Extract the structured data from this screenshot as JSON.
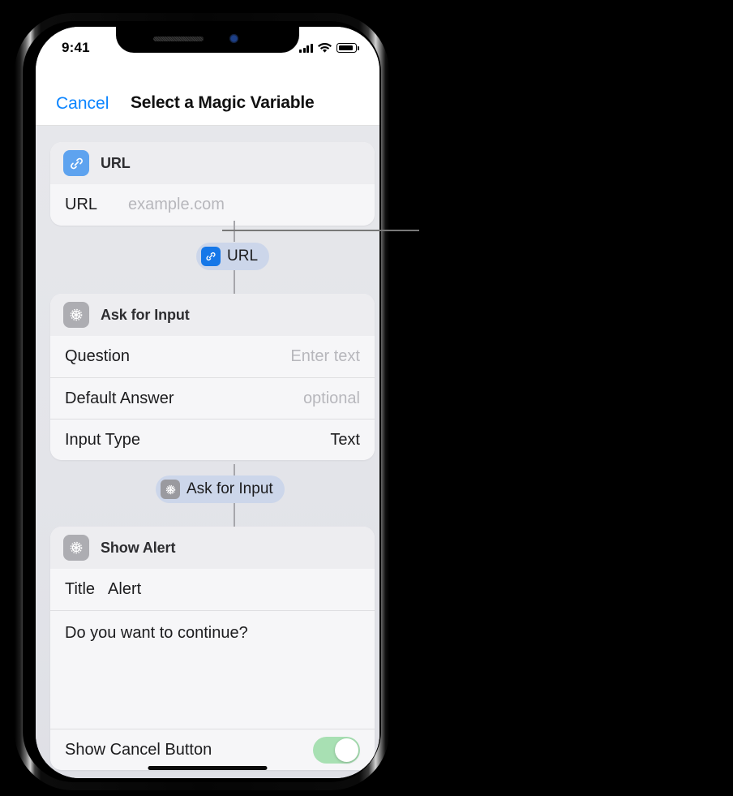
{
  "device": {
    "status_bar": {
      "time": "9:41",
      "cellular_icon": "signal-bars-icon",
      "wifi_icon": "wifi-icon",
      "battery_icon": "battery-icon"
    },
    "home_indicator": "home-indicator"
  },
  "nav": {
    "cancel_label": "Cancel",
    "title": "Select a Magic Variable"
  },
  "cards": [
    {
      "id": "url-action",
      "icon": "link-icon",
      "icon_color": "#5ea3ef",
      "title": "URL",
      "rows": [
        {
          "label": "URL",
          "value": "example.com",
          "is_placeholder": true
        }
      ]
    },
    {
      "id": "ask-for-input-action",
      "icon": "gear-icon",
      "icon_color": "#adadb2",
      "title": "Ask for Input",
      "rows": [
        {
          "label": "Question",
          "value": "Enter text",
          "is_placeholder": true
        },
        {
          "label": "Default Answer",
          "value": "optional",
          "is_placeholder": true
        },
        {
          "label": "Input Type",
          "value": "Text",
          "is_placeholder": false
        }
      ]
    },
    {
      "id": "show-alert-action",
      "icon": "gear-icon",
      "icon_color": "#adadb2",
      "title": "Show Alert",
      "rows": [
        {
          "label": "Title",
          "value": "Alert",
          "is_placeholder": false
        }
      ],
      "message_text": "Do you want to continue?",
      "toggle_row": {
        "label": "Show Cancel Button",
        "state": "on",
        "track_color": "#a8e0b3"
      }
    }
  ],
  "variable_pills": [
    {
      "id": "url-variable-pill",
      "icon": "link-icon",
      "icon_color": "#1577e8",
      "label": "URL",
      "selected": true,
      "background": "#ccd6ea"
    },
    {
      "id": "ask-for-input-variable-pill",
      "icon": "gear-icon",
      "icon_color": "#9a9a9f",
      "label": "Ask for Input",
      "selected": true,
      "background": "#ccd6ea"
    }
  ],
  "annotation": {
    "callout_line_color": "#787878"
  },
  "colors": {
    "accent_blue": "#0a84ff",
    "screen_background": "#e3e4e9",
    "card_background": "#f6f6f8",
    "card_header_background": "#ededf0"
  }
}
